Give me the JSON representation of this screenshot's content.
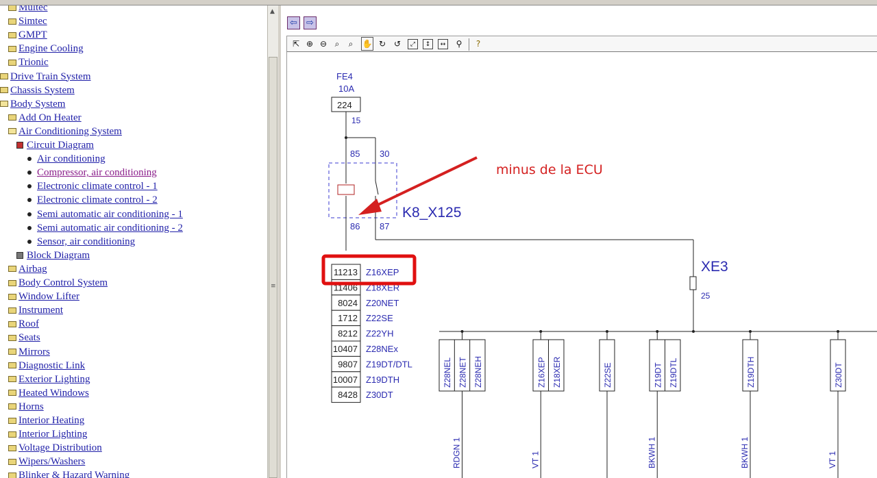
{
  "tree": {
    "items": [
      {
        "label": "Multec",
        "indent": 2,
        "icon": "folder-icon"
      },
      {
        "label": "Simtec",
        "indent": 2,
        "icon": "folder-icon"
      },
      {
        "label": "GMPT",
        "indent": 2,
        "icon": "folder-icon"
      },
      {
        "label": "Engine Cooling",
        "indent": 2,
        "icon": "folder-icon"
      },
      {
        "label": "Trionic",
        "indent": 2,
        "icon": "folder-icon"
      },
      {
        "label": "Drive Train System",
        "indent": 1,
        "icon": "folder-icon"
      },
      {
        "label": "Chassis System",
        "indent": 1,
        "icon": "folder-icon"
      },
      {
        "label": "Body System",
        "indent": 1,
        "icon": "folder-open-icon"
      },
      {
        "label": "Add On Heater",
        "indent": 2,
        "icon": "folder-icon"
      },
      {
        "label": "Air Conditioning System",
        "indent": 2,
        "icon": "folder-open-icon"
      },
      {
        "label": "Circuit Diagram",
        "indent": 3,
        "icon": "book-open-icon"
      },
      {
        "label": "Air conditioning",
        "indent": 4,
        "icon": "bullet-icon"
      },
      {
        "label": "Compressor, air conditioning",
        "indent": 4,
        "icon": "bullet-icon",
        "visited": true
      },
      {
        "label": "Electronic climate control - 1",
        "indent": 4,
        "icon": "bullet-icon"
      },
      {
        "label": "Electronic climate control - 2",
        "indent": 4,
        "icon": "bullet-icon"
      },
      {
        "label": "Semi automatic air conditioning - 1",
        "indent": 4,
        "icon": "bullet-icon"
      },
      {
        "label": "Semi automatic air conditioning - 2",
        "indent": 4,
        "icon": "bullet-icon"
      },
      {
        "label": "Sensor, air conditioning",
        "indent": 4,
        "icon": "bullet-icon"
      },
      {
        "label": "Block Diagram",
        "indent": 3,
        "icon": "book-icon"
      },
      {
        "label": "Airbag",
        "indent": 2,
        "icon": "folder-icon"
      },
      {
        "label": "Body Control System",
        "indent": 2,
        "icon": "folder-icon"
      },
      {
        "label": "Window Lifter",
        "indent": 2,
        "icon": "folder-icon"
      },
      {
        "label": "Instrument",
        "indent": 2,
        "icon": "folder-icon"
      },
      {
        "label": "Roof",
        "indent": 2,
        "icon": "folder-icon"
      },
      {
        "label": "Seats",
        "indent": 2,
        "icon": "folder-icon"
      },
      {
        "label": "Mirrors",
        "indent": 2,
        "icon": "folder-icon"
      },
      {
        "label": "Diagnostic Link",
        "indent": 2,
        "icon": "folder-icon"
      },
      {
        "label": "Exterior Lighting",
        "indent": 2,
        "icon": "folder-icon"
      },
      {
        "label": "Heated Windows",
        "indent": 2,
        "icon": "folder-icon"
      },
      {
        "label": "Horns",
        "indent": 2,
        "icon": "folder-icon"
      },
      {
        "label": "Interior Heating",
        "indent": 2,
        "icon": "folder-icon"
      },
      {
        "label": "Interior Lighting",
        "indent": 2,
        "icon": "folder-icon"
      },
      {
        "label": "Voltage Distribution",
        "indent": 2,
        "icon": "folder-icon"
      },
      {
        "label": "Wipers/Washers",
        "indent": 2,
        "icon": "folder-icon"
      },
      {
        "label": "Blinker & Hazard Warning",
        "indent": 2,
        "icon": "folder-icon"
      }
    ]
  },
  "viewer": {
    "nav": {
      "back_icon": "arrow-left-icon",
      "forward_icon": "arrow-right-icon"
    },
    "toolbar_icons": [
      "select-arrow-icon",
      "zoom-in-icon",
      "zoom-out-icon",
      "zoom-icon",
      "zoom-area-icon",
      "pan-hand-icon",
      "rotate-right-icon",
      "rotate-left-icon",
      "fit-all-icon",
      "fit-height-icon",
      "fit-width-icon",
      "measure-icon",
      "help-icon"
    ]
  },
  "diagram": {
    "fuse": {
      "name": "FE4",
      "rating": "10A",
      "number": "224",
      "pin": "15"
    },
    "relay": {
      "name": "K8_X125",
      "pins": {
        "p85": "85",
        "p30": "30",
        "p86": "86",
        "p87": "87"
      }
    },
    "connector": {
      "name": "XE3",
      "pin": "25"
    },
    "annotation": {
      "text": "minus de la ECU",
      "color": "#d42020"
    },
    "engine_table": [
      {
        "code": "11213",
        "engine": "Z16XEP",
        "highlighted": true
      },
      {
        "code": "11406",
        "engine": "Z18XER"
      },
      {
        "code": "8024",
        "engine": "Z20NET"
      },
      {
        "code": "1712",
        "engine": "Z22SE"
      },
      {
        "code": "8212",
        "engine": "Z22YH"
      },
      {
        "code": "10407",
        "engine": "Z28NEx"
      },
      {
        "code": "9807",
        "engine": "Z19DT/DTL"
      },
      {
        "code": "10007",
        "engine": "Z19DTH"
      },
      {
        "code": "8428",
        "engine": "Z30DT"
      }
    ],
    "branch_boxes": [
      {
        "labels": [
          "Z28NEL",
          "Z28NET",
          "Z28NEH"
        ],
        "wire": "RDGN 1"
      },
      {
        "labels": [
          "Z16XEP",
          "Z18XER"
        ],
        "wire": "VT 1"
      },
      {
        "labels": [
          "Z22SE"
        ],
        "wire": ""
      },
      {
        "labels": [
          "Z19DT",
          "Z19DTL"
        ],
        "wire": "BKWH 1"
      },
      {
        "labels": [
          "Z19DTH"
        ],
        "wire": "BKWH 1"
      },
      {
        "labels": [
          "Z30DT"
        ],
        "wire": "VT 1"
      }
    ],
    "colors": {
      "line": "#222222",
      "label": "#2a2ab0",
      "relay_dash": "#3a3ad0",
      "coil": "#b02020",
      "highlight": "#e01010"
    }
  }
}
